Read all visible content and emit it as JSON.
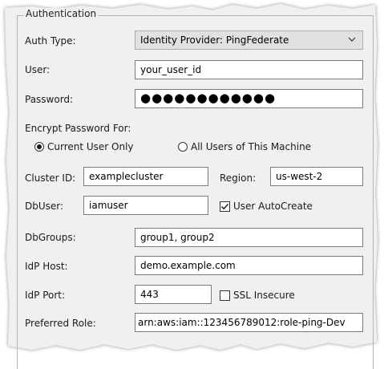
{
  "section": {
    "legend": "Authentication"
  },
  "auth_type": {
    "label": "Auth Type:",
    "value": "Identity Provider: PingFederate"
  },
  "user": {
    "label": "User:",
    "value": "your_user_id"
  },
  "password": {
    "label": "Password:",
    "value": "●●●●●●●●●●●●"
  },
  "encrypt": {
    "label": "Encrypt Password For:",
    "options": [
      {
        "label": "Current User Only",
        "selected": true
      },
      {
        "label": "All Users of This Machine",
        "selected": false
      }
    ]
  },
  "cluster": {
    "label": "Cluster ID:",
    "value": "examplecluster"
  },
  "region": {
    "label": "Region:",
    "value": "us-west-2"
  },
  "dbuser": {
    "label": "DbUser:",
    "value": "iamuser"
  },
  "autocreate": {
    "label": "User AutoCreate",
    "checked": true
  },
  "dbgroups": {
    "label": "DbGroups:",
    "value": "group1, group2"
  },
  "idp_host": {
    "label": "IdP Host:",
    "value": "demo.example.com"
  },
  "idp_port": {
    "label": "IdP Port:",
    "value": "443"
  },
  "ssl": {
    "label": "SSL Insecure",
    "checked": false
  },
  "preferred_role": {
    "label": "Preferred Role:",
    "value": "arn:aws:iam::123456789012:role-ping-Dev"
  }
}
